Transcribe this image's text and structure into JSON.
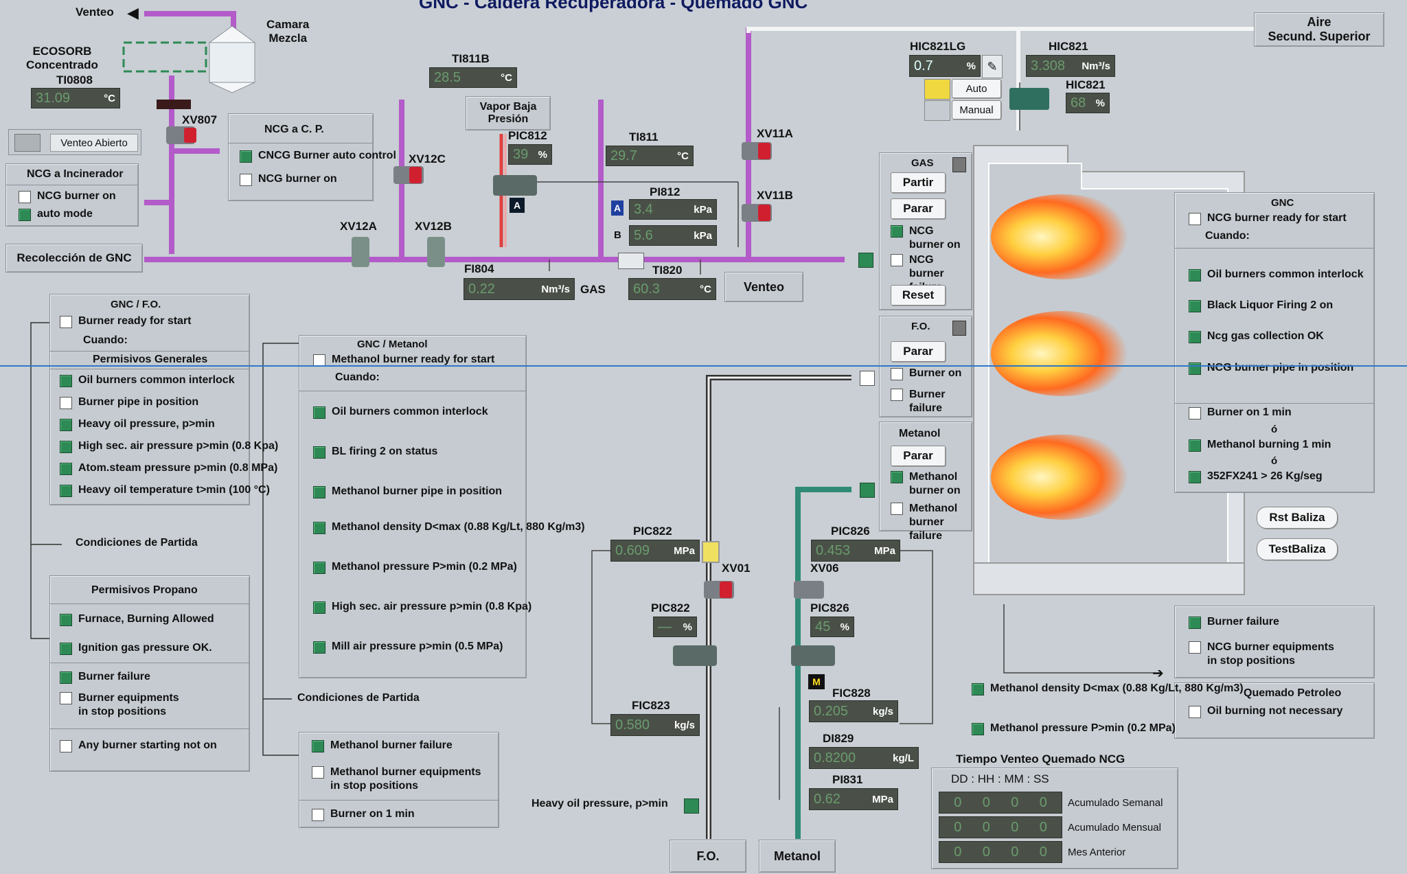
{
  "title": {
    "text": "GNC - Caldera Recuperadora - Quemado GNC"
  },
  "top_left": {
    "venteo": "Venteo",
    "camara": "Camara\nMezcla",
    "ecosorb": "ECOSORB\nConcentrado",
    "ti0808": "TI0808",
    "ti0808_val": "31.09",
    "ti0808_unit": "°C",
    "xv807": "XV807",
    "venteo_abierto": "Venteo Abierto"
  },
  "ncg_cp": {
    "title": "NCG a C. P.",
    "items": [
      {
        "label": "CNCG Burner auto control",
        "on": true
      },
      {
        "label": "NCG burner on",
        "on": false
      }
    ]
  },
  "ncg_inc": {
    "title": "NCG a Incinerador",
    "items": [
      {
        "label": "NCG burner on",
        "on": false
      },
      {
        "label": "auto mode",
        "on": true
      }
    ]
  },
  "recoleccion": "Recolección de GNC",
  "valves": {
    "xv12a": "XV12A",
    "xv12b": "XV12B",
    "xv12c": "XV12C",
    "xv11a": "XV11A",
    "xv11b": "XV11B",
    "xv01": "XV01",
    "xv06": "XV06"
  },
  "ti811b": {
    "tag": "TI811B",
    "value": "28.5",
    "unit": "°C"
  },
  "vapor": "Vapor Baja\nPresión",
  "pic812": {
    "tag": "PIC812",
    "value": "39",
    "unit": "%",
    "mode": "A"
  },
  "ti811": {
    "tag": "TI811",
    "value": "29.7",
    "unit": "°C"
  },
  "pi812": {
    "tag": "PI812",
    "a_label": "A",
    "a_value": "3.4",
    "b_label": "B",
    "b_value": "5.6",
    "unit": "kPa"
  },
  "fi804": {
    "tag": "FI804",
    "value": "0.22",
    "unit": "Nm³/s",
    "suffix": "GAS"
  },
  "ti820": {
    "tag": "TI820",
    "value": "60.3",
    "unit": "°C"
  },
  "venteo2": "Venteo",
  "aire": "Aire\nSecund. Superior",
  "hic821lg": {
    "tag": "HIC821LG",
    "value": "0.7",
    "unit": "%",
    "auto": "Auto",
    "manual": "Manual"
  },
  "hic821": {
    "tag": "HIC821",
    "value": "3.308",
    "unit": "Nm³/s",
    "tag2": "HIC821",
    "value2": "68",
    "unit2": "%"
  },
  "gas": {
    "title": "GAS",
    "partir": "Partir",
    "parar": "Parar",
    "ncg_on": "NCG\nburner on",
    "ncg_fail": "NCG\nburner failure",
    "reset": "Reset"
  },
  "fo": {
    "title": "F.O.",
    "parar": "Parar",
    "burner_on": "Burner on",
    "burner_fail": "Burner\nfailure"
  },
  "metanol": {
    "title": "Metanol",
    "parar": "Parar",
    "on": "Methanol\nburner on",
    "fail": "Methanol\nburner failure"
  },
  "gnc_right": {
    "title": "GNC",
    "ready": "NCG burner ready for start",
    "cuando": "Cuando:",
    "items": [
      {
        "label": "Oil burners common interlock",
        "on": true
      },
      {
        "label": "Black Liquor Firing 2 on",
        "on": true
      },
      {
        "label": "Ncg gas collection OK",
        "on": true
      },
      {
        "label": "NCG burner pipe in position",
        "on": true
      }
    ],
    "b1": "Burner on 1 min",
    "o1": "ó",
    "b2": "Methanol burning 1 min",
    "o2": "ó",
    "b3": "352FX241 > 26 Kg/seg"
  },
  "rst_baliza": "Rst Baliza",
  "test_baliza": "TestBaliza",
  "gnc_fo": {
    "title": "GNC / F.O.",
    "ready": "Burner ready for start",
    "cuando": "Cuando:",
    "permisos": "Permisivos Generales",
    "items": [
      {
        "label": "Oil burners common interlock",
        "on": true
      },
      {
        "label": "Burner pipe in position",
        "on": false
      },
      {
        "label": "Heavy oil pressure, p>min",
        "on": true
      },
      {
        "label": "High sec. air pressure p>min (0.8 Kpa)",
        "on": true
      },
      {
        "label": "Atom.steam pressure p>min (0.8 MPa)",
        "on": true
      },
      {
        "label": "Heavy oil temperature t>min (100 °C)",
        "on": true
      }
    ],
    "condiciones": "Condiciones de Partida",
    "propano": "Permisivos Propano",
    "prop_items": [
      {
        "label": "Furnace, Burning Allowed",
        "on": true
      },
      {
        "label": "Ignition gas pressure OK.",
        "on": true
      }
    ],
    "bf": "Burner failure",
    "be": "Burner equipments\nin stop positions",
    "any": "Any burner starting not on"
  },
  "gnc_met": {
    "title": "GNC / Metanol",
    "ready": "Methanol burner ready for start",
    "cuando": "Cuando:",
    "items": [
      {
        "label": "Oil burners common interlock",
        "on": true
      },
      {
        "label": "BL firing 2 on status",
        "on": true
      },
      {
        "label": "Methanol burner pipe in position",
        "on": true
      },
      {
        "label": "Methanol density D<max (0.88 Kg/Lt, 880 Kg/m3)",
        "on": true
      },
      {
        "label": "Methanol pressure P>min (0.2 MPa)",
        "on": true
      },
      {
        "label": "High sec. air pressure p>min (0.8 Kpa)",
        "on": true
      },
      {
        "label": "Mill air pressure p>min (0.5 MPa)",
        "on": true
      }
    ],
    "condiciones": "Condiciones de Partida",
    "mbf": "Methanol burner failure",
    "mbe": "Methanol burner equipments\nin stop positions",
    "bon": "Burner on 1 min"
  },
  "pic822": {
    "tag": "PIC822",
    "value": "0.609",
    "unit": "MPa",
    "tag2": "PIC822",
    "value2": "—",
    "unit2": "%"
  },
  "fic823": {
    "tag": "FIC823",
    "value": "0.580",
    "unit": "kg/s"
  },
  "pic826": {
    "tag": "PIC826",
    "value": "0.453",
    "unit": "MPa",
    "tag2": "PIC826",
    "value2": "45",
    "unit2": "%"
  },
  "fic828": {
    "tag": "FIC828",
    "value": "0.205",
    "unit": "kg/s",
    "mode": "M"
  },
  "di829": {
    "tag": "DI829",
    "value": "0.8200",
    "unit": "kg/L"
  },
  "pi831": {
    "tag": "PI831",
    "value": "0.62",
    "unit": "MPa"
  },
  "heavy_oil": "Heavy oil pressure, p>min",
  "fo_label": "F.O.",
  "metanol_label": "Metanol",
  "right_bottom": {
    "bf": "Burner failure",
    "be": "NCG burner equipments\nin stop positions",
    "qp": "Quemado Petroleo",
    "oil": "Oil burning not necessary"
  },
  "mid_bottom": {
    "d": "Methanol density D<max (0.88 Kg/Lt, 880 Kg/m3)",
    "p": "Methanol pressure P>min (0.2 MPa)"
  },
  "tiempo": {
    "title": "Tiempo Venteo  Quemado NCG",
    "fmt": "DD : HH : MM : SS",
    "rows": [
      {
        "label": "Acumulado Semanal",
        "v": [
          "0",
          "0",
          "0",
          "0"
        ]
      },
      {
        "label": "Acumulado Mensual",
        "v": [
          "0",
          "0",
          "0",
          "0"
        ]
      },
      {
        "label": "Mes Anterior",
        "v": [
          "0",
          "0",
          "0",
          "0"
        ]
      }
    ]
  }
}
